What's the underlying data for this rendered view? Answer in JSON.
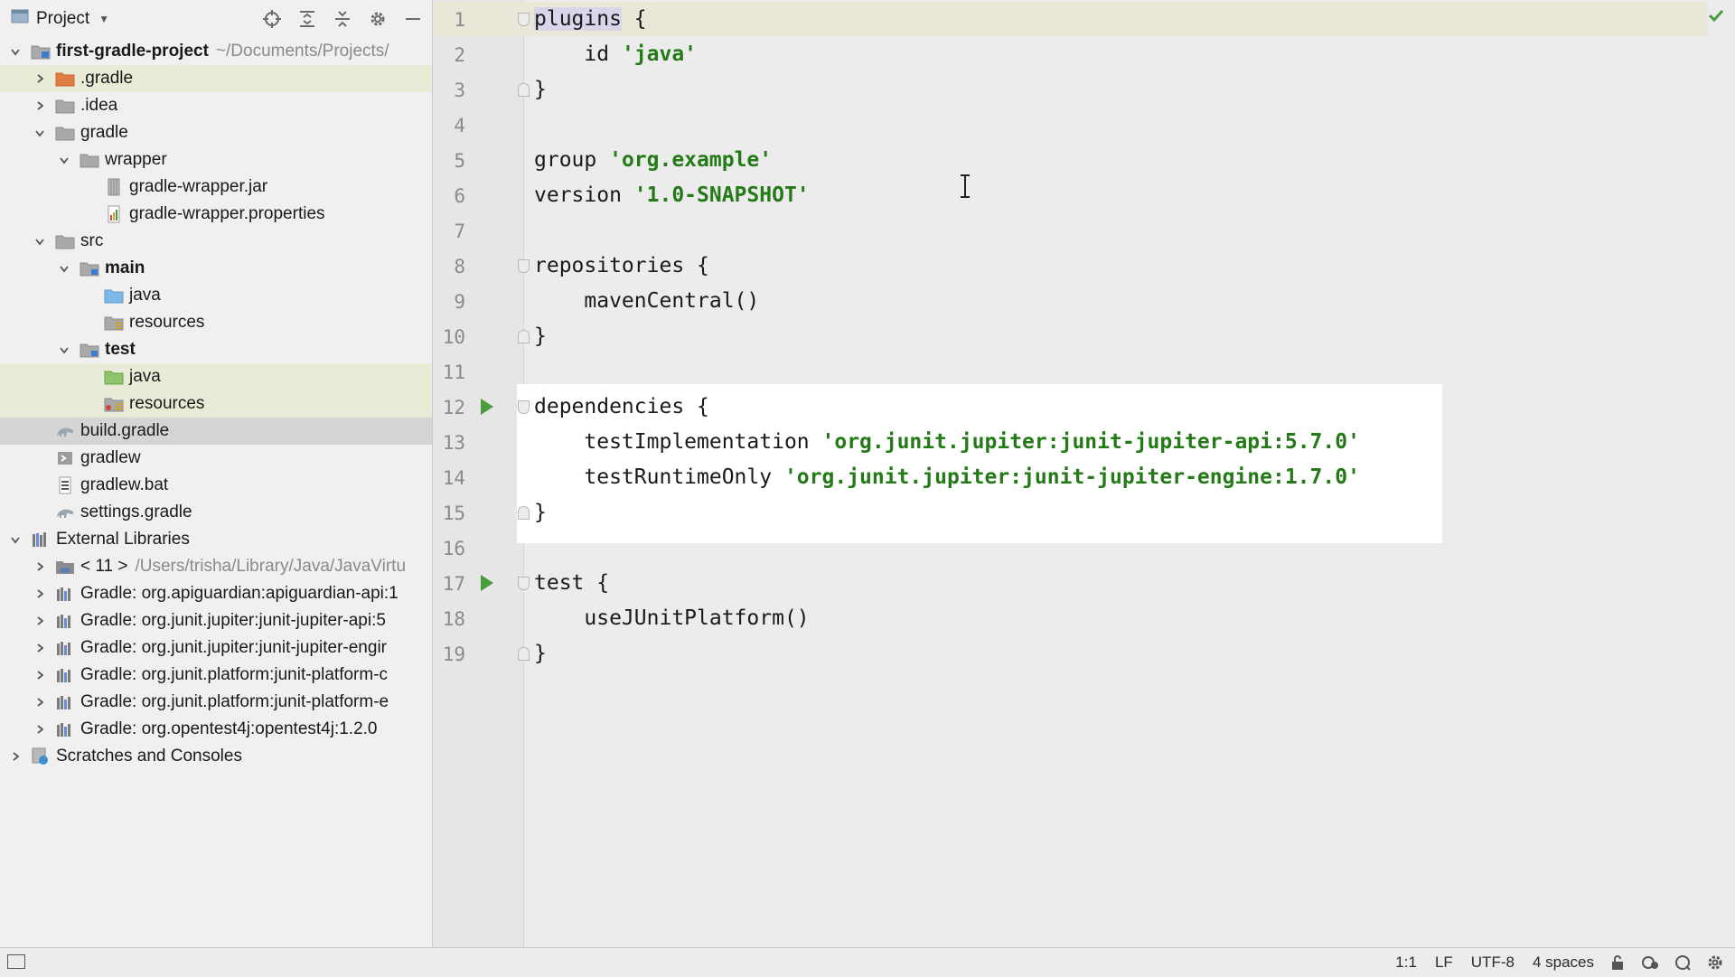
{
  "project_panel": {
    "title": "Project",
    "tree": [
      {
        "label": "first-gradle-project",
        "path": "~/Documents/Projects/",
        "indent": 0,
        "expanded": true,
        "icon": "project-module-icon",
        "bold": true,
        "name": "tree-item-first-gradle-project"
      },
      {
        "label": ".gradle",
        "indent": 1,
        "expanded": false,
        "icon": "folder-orange-icon",
        "highlight": true,
        "name": "tree-item-dot-gradle"
      },
      {
        "label": ".idea",
        "indent": 1,
        "expanded": false,
        "icon": "folder-icon",
        "name": "tree-item-dot-idea"
      },
      {
        "label": "gradle",
        "indent": 1,
        "expanded": true,
        "icon": "folder-icon",
        "name": "tree-item-gradle"
      },
      {
        "label": "wrapper",
        "indent": 2,
        "expanded": true,
        "icon": "folder-icon",
        "name": "tree-item-wrapper"
      },
      {
        "label": "gradle-wrapper.jar",
        "indent": 3,
        "icon": "jar-file-icon",
        "name": "tree-item-gradle-wrapper-jar"
      },
      {
        "label": "gradle-wrapper.properties",
        "indent": 3,
        "icon": "properties-file-icon",
        "name": "tree-item-gradle-wrapper-properties"
      },
      {
        "label": "src",
        "indent": 1,
        "expanded": true,
        "icon": "folder-icon",
        "name": "tree-item-src"
      },
      {
        "label": "main",
        "indent": 2,
        "expanded": true,
        "icon": "source-set-folder-icon",
        "bold": true,
        "name": "tree-item-main"
      },
      {
        "label": "java",
        "indent": 3,
        "icon": "source-root-folder-icon",
        "name": "tree-item-main-java"
      },
      {
        "label": "resources",
        "indent": 3,
        "icon": "resources-folder-icon",
        "name": "tree-item-main-resources"
      },
      {
        "label": "test",
        "indent": 2,
        "expanded": true,
        "icon": "source-set-folder-icon",
        "bold": true,
        "name": "tree-item-test"
      },
      {
        "label": "java",
        "indent": 3,
        "icon": "test-root-folder-icon",
        "highlight": true,
        "name": "tree-item-test-java"
      },
      {
        "label": "resources",
        "indent": 3,
        "icon": "test-resources-folder-icon",
        "highlight": true,
        "name": "tree-item-test-resources"
      },
      {
        "label": "build.gradle",
        "indent": 1,
        "icon": "gradle-file-icon",
        "selected": true,
        "name": "tree-item-build-gradle"
      },
      {
        "label": "gradlew",
        "indent": 1,
        "icon": "shell-file-icon",
        "name": "tree-item-gradlew"
      },
      {
        "label": "gradlew.bat",
        "indent": 1,
        "icon": "bat-file-icon",
        "name": "tree-item-gradlew-bat"
      },
      {
        "label": "settings.gradle",
        "indent": 1,
        "icon": "gradle-file-icon",
        "name": "tree-item-settings-gradle"
      },
      {
        "label": "External Libraries",
        "indent": 0,
        "expanded": true,
        "icon": "libraries-icon",
        "name": "tree-item-external-libraries"
      },
      {
        "label": "< 11 >",
        "path": "/Users/trisha/Library/Java/JavaVirtu",
        "indent": 1,
        "expanded": false,
        "icon": "jdk-icon",
        "name": "tree-item-jdk-11"
      },
      {
        "label": "Gradle: org.apiguardian:apiguardian-api:1",
        "indent": 1,
        "expanded": false,
        "icon": "library-icon",
        "name": "tree-item-lib-apiguardian"
      },
      {
        "label": "Gradle: org.junit.jupiter:junit-jupiter-api:5",
        "indent": 1,
        "expanded": false,
        "icon": "library-icon",
        "name": "tree-item-lib-junit-jupiter-api"
      },
      {
        "label": "Gradle: org.junit.jupiter:junit-jupiter-engir",
        "indent": 1,
        "expanded": false,
        "icon": "library-icon",
        "name": "tree-item-lib-junit-jupiter-engine"
      },
      {
        "label": "Gradle: org.junit.platform:junit-platform-c",
        "indent": 1,
        "expanded": false,
        "icon": "library-icon",
        "name": "tree-item-lib-junit-platform-commons"
      },
      {
        "label": "Gradle: org.junit.platform:junit-platform-e",
        "indent": 1,
        "expanded": false,
        "icon": "library-icon",
        "name": "tree-item-lib-junit-platform-engine"
      },
      {
        "label": "Gradle: org.opentest4j:opentest4j:1.2.0",
        "indent": 1,
        "expanded": false,
        "icon": "library-icon",
        "name": "tree-item-lib-opentest4j"
      },
      {
        "label": "Scratches and Consoles",
        "indent": 0,
        "expanded": false,
        "icon": "scratches-icon",
        "name": "tree-item-scratches-and-consoles"
      }
    ]
  },
  "editor": {
    "lines": [
      {
        "n": "1",
        "tokens": [
          {
            "t": "plugins",
            "c": "kw-hl"
          },
          {
            "t": " {",
            "c": ""
          }
        ],
        "fold": "open"
      },
      {
        "n": "2",
        "tokens": [
          {
            "t": "    id ",
            "c": ""
          },
          {
            "t": "'java'",
            "c": "str"
          }
        ]
      },
      {
        "n": "3",
        "tokens": [
          {
            "t": "}",
            "c": ""
          }
        ],
        "fold": "close"
      },
      {
        "n": "4",
        "tokens": []
      },
      {
        "n": "5",
        "tokens": [
          {
            "t": "group ",
            "c": ""
          },
          {
            "t": "'org.example'",
            "c": "str"
          }
        ]
      },
      {
        "n": "6",
        "tokens": [
          {
            "t": "version ",
            "c": ""
          },
          {
            "t": "'1.0-SNAPSHOT'",
            "c": "str"
          }
        ]
      },
      {
        "n": "7",
        "tokens": []
      },
      {
        "n": "8",
        "tokens": [
          {
            "t": "repositories {",
            "c": ""
          }
        ],
        "fold": "open"
      },
      {
        "n": "9",
        "tokens": [
          {
            "t": "    mavenCentral()",
            "c": ""
          }
        ]
      },
      {
        "n": "10",
        "tokens": [
          {
            "t": "}",
            "c": ""
          }
        ],
        "fold": "close"
      },
      {
        "n": "11",
        "tokens": []
      },
      {
        "n": "12",
        "tokens": [
          {
            "t": "dependencies {",
            "c": ""
          }
        ],
        "fold": "open",
        "run": true
      },
      {
        "n": "13",
        "tokens": [
          {
            "t": "    testImplementation ",
            "c": ""
          },
          {
            "t": "'org.junit.jupiter:junit-jupiter-api:5.7.0'",
            "c": "str"
          }
        ]
      },
      {
        "n": "14",
        "tokens": [
          {
            "t": "    testRuntimeOnly ",
            "c": ""
          },
          {
            "t": "'org.junit.jupiter:junit-jupiter-engine:1.7.0'",
            "c": "str"
          }
        ]
      },
      {
        "n": "15",
        "tokens": [
          {
            "t": "}",
            "c": ""
          }
        ],
        "fold": "close"
      },
      {
        "n": "16",
        "tokens": []
      },
      {
        "n": "17",
        "tokens": [
          {
            "t": "test {",
            "c": ""
          }
        ],
        "fold": "open",
        "run": true
      },
      {
        "n": "18",
        "tokens": [
          {
            "t": "    useJUnitPlatform()",
            "c": ""
          }
        ]
      },
      {
        "n": "19",
        "tokens": [
          {
            "t": "}",
            "c": ""
          }
        ],
        "fold": "close"
      }
    ]
  },
  "status_bar": {
    "position": "1:1",
    "line_separator": "LF",
    "encoding": "UTF-8",
    "indent": "4 spaces"
  },
  "colors": {
    "string": "#257a18",
    "run_gutter": "#4a9c3d",
    "selection_row": "#d5d5d5",
    "highlight_row": "#e8ecd6"
  }
}
